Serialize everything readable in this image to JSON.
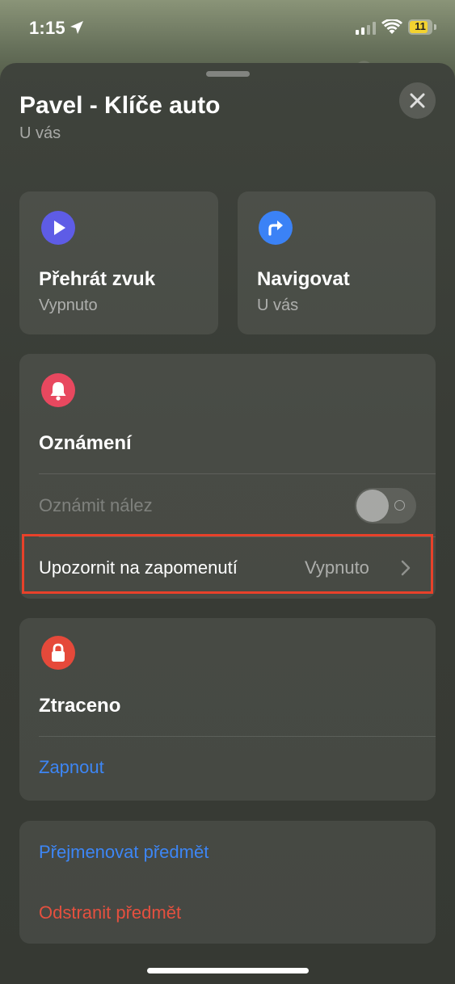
{
  "status_bar": {
    "time": "1:15",
    "battery": "11"
  },
  "header": {
    "title": "Pavel - Klíče auto",
    "subtitle": "U vás"
  },
  "actions": {
    "play_sound": {
      "title": "Přehrát zvuk",
      "subtitle": "Vypnuto",
      "icon": "play-icon",
      "color": "#5e5ce6"
    },
    "navigate": {
      "title": "Navigovat",
      "subtitle": "U vás",
      "icon": "directions-arrow-icon",
      "color": "#3b82f6"
    }
  },
  "notifications": {
    "title": "Oznámení",
    "icon": "bell-icon",
    "color": "#e8485f",
    "notify_found_label": "Oznámit nález",
    "notify_found_enabled": false,
    "forget_alert_label": "Upozornit na zapomenutí",
    "forget_alert_value": "Vypnuto"
  },
  "lost": {
    "title": "Ztraceno",
    "icon": "lock-icon",
    "color": "#e5493a",
    "enable_label": "Zapnout"
  },
  "item_actions": {
    "rename_label": "Přejmenovat předmět",
    "remove_label": "Odstranit předmět"
  },
  "colors": {
    "link_blue": "#3d86f5",
    "destructive_red": "#e5503f",
    "highlight_border": "#e8412a"
  }
}
